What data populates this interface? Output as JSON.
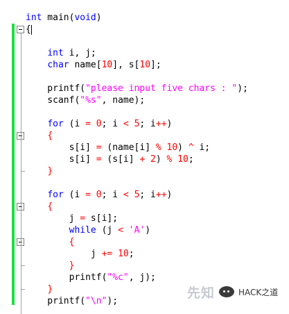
{
  "code": {
    "lines": [
      [
        {
          "t": "int",
          "c": "kw"
        },
        {
          "t": " main("
        },
        {
          "t": "void",
          "c": "kw"
        },
        {
          "t": ")"
        }
      ],
      [
        {
          "t": "{"
        }
      ],
      [
        {
          "t": ""
        }
      ],
      [
        {
          "t": "    "
        },
        {
          "t": "int",
          "c": "kw"
        },
        {
          "t": " i, j;"
        }
      ],
      [
        {
          "t": "    "
        },
        {
          "t": "char",
          "c": "kw"
        },
        {
          "t": " name["
        },
        {
          "t": "10",
          "c": "op"
        },
        {
          "t": "], s["
        },
        {
          "t": "10",
          "c": "op"
        },
        {
          "t": "];"
        }
      ],
      [
        {
          "t": ""
        }
      ],
      [
        {
          "t": "    printf("
        },
        {
          "t": "\"please input five chars : \"",
          "c": "str"
        },
        {
          "t": ");"
        }
      ],
      [
        {
          "t": "    scanf("
        },
        {
          "t": "\"%s\"",
          "c": "str"
        },
        {
          "t": ", name);"
        }
      ],
      [
        {
          "t": ""
        }
      ],
      [
        {
          "t": "    "
        },
        {
          "t": "for",
          "c": "kw"
        },
        {
          "t": " (i "
        },
        {
          "t": "=",
          "c": "op"
        },
        {
          "t": " "
        },
        {
          "t": "0",
          "c": "op"
        },
        {
          "t": "; i "
        },
        {
          "t": "<",
          "c": "op"
        },
        {
          "t": " "
        },
        {
          "t": "5",
          "c": "op"
        },
        {
          "t": "; i"
        },
        {
          "t": "++",
          "c": "op"
        },
        {
          "t": ")"
        }
      ],
      [
        {
          "t": "    "
        },
        {
          "t": "{",
          "c": "op"
        }
      ],
      [
        {
          "t": "        s[i] "
        },
        {
          "t": "=",
          "c": "op"
        },
        {
          "t": " (name[i] "
        },
        {
          "t": "%",
          "c": "op"
        },
        {
          "t": " "
        },
        {
          "t": "10",
          "c": "op"
        },
        {
          "t": ") "
        },
        {
          "t": "^",
          "c": "op"
        },
        {
          "t": " i;"
        }
      ],
      [
        {
          "t": "        s[i] "
        },
        {
          "t": "=",
          "c": "op"
        },
        {
          "t": " (s[i] "
        },
        {
          "t": "+",
          "c": "op"
        },
        {
          "t": " "
        },
        {
          "t": "2",
          "c": "op"
        },
        {
          "t": ") "
        },
        {
          "t": "%",
          "c": "op"
        },
        {
          "t": " "
        },
        {
          "t": "10",
          "c": "op"
        },
        {
          "t": ";"
        }
      ],
      [
        {
          "t": "    "
        },
        {
          "t": "}",
          "c": "op"
        }
      ],
      [
        {
          "t": ""
        }
      ],
      [
        {
          "t": "    "
        },
        {
          "t": "for",
          "c": "kw"
        },
        {
          "t": " (i "
        },
        {
          "t": "=",
          "c": "op"
        },
        {
          "t": " "
        },
        {
          "t": "0",
          "c": "op"
        },
        {
          "t": "; i "
        },
        {
          "t": "<",
          "c": "op"
        },
        {
          "t": " "
        },
        {
          "t": "5",
          "c": "op"
        },
        {
          "t": "; i"
        },
        {
          "t": "++",
          "c": "op"
        },
        {
          "t": ")"
        }
      ],
      [
        {
          "t": "    "
        },
        {
          "t": "{",
          "c": "op"
        }
      ],
      [
        {
          "t": "        j "
        },
        {
          "t": "=",
          "c": "op"
        },
        {
          "t": " s[i];"
        }
      ],
      [
        {
          "t": "        "
        },
        {
          "t": "while",
          "c": "kw"
        },
        {
          "t": " (j "
        },
        {
          "t": "<",
          "c": "op"
        },
        {
          "t": " "
        },
        {
          "t": "'A'",
          "c": "str"
        },
        {
          "t": ")"
        }
      ],
      [
        {
          "t": "        "
        },
        {
          "t": "{",
          "c": "op"
        }
      ],
      [
        {
          "t": "            j "
        },
        {
          "t": "+=",
          "c": "op"
        },
        {
          "t": " "
        },
        {
          "t": "10",
          "c": "op"
        },
        {
          "t": ";"
        }
      ],
      [
        {
          "t": "        "
        },
        {
          "t": "}",
          "c": "op"
        }
      ],
      [
        {
          "t": "        printf("
        },
        {
          "t": "\"%c\"",
          "c": "str"
        },
        {
          "t": ", j);"
        }
      ],
      [
        {
          "t": "    "
        },
        {
          "t": "}",
          "c": "op"
        }
      ],
      [
        {
          "t": "    printf("
        },
        {
          "t": "\"\\n\"",
          "c": "str"
        },
        {
          "t": ");"
        }
      ]
    ],
    "fold_markers": [
      1,
      10,
      16,
      19
    ],
    "colors": {
      "keyword": "#0000ff",
      "string": "#ff00ff",
      "operator": "#ff0000",
      "change_bar": "#22dd44"
    }
  },
  "watermark": {
    "logo_text": "先知",
    "account_icon": "wechat-icon",
    "account_text": "HACK之道"
  }
}
